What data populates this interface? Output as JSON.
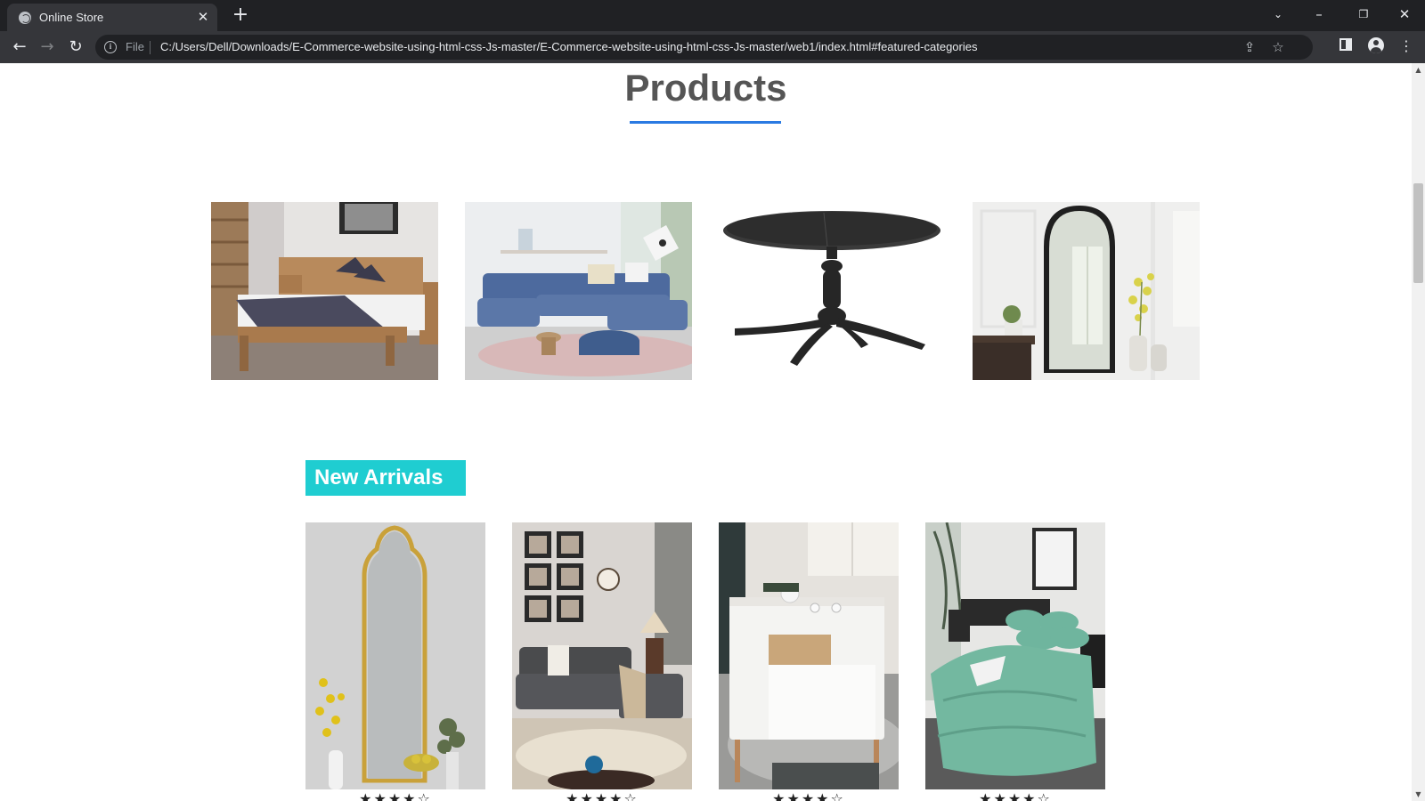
{
  "browser": {
    "tab_title": "Online Store",
    "file_label": "File",
    "url": "C:/Users/Dell/Downloads/E-Commerce-website-using-html-css-Js-master/E-Commerce-website-using-html-css-Js-master/web1/index.html#featured-categories"
  },
  "page": {
    "products_heading": "Products",
    "new_arrivals_label": "New Arrivals",
    "featured_categories": [
      {
        "icon": "bed-image"
      },
      {
        "icon": "sofa-image"
      },
      {
        "icon": "round-table-image"
      },
      {
        "icon": "floor-mirror-image"
      }
    ],
    "new_arrivals": [
      {
        "icon": "gold-mirror-image",
        "rating_text": "★★★★☆"
      },
      {
        "icon": "grey-sofa-image",
        "rating_text": "★★★★☆"
      },
      {
        "icon": "white-cabinet-image",
        "rating_text": "★★★★☆"
      },
      {
        "icon": "green-bedding-image",
        "rating_text": "★★★★☆"
      }
    ]
  },
  "colors": {
    "accent_blue": "#2a7ae2",
    "badge_teal": "#1fcdd1",
    "heading_grey": "#555555"
  }
}
